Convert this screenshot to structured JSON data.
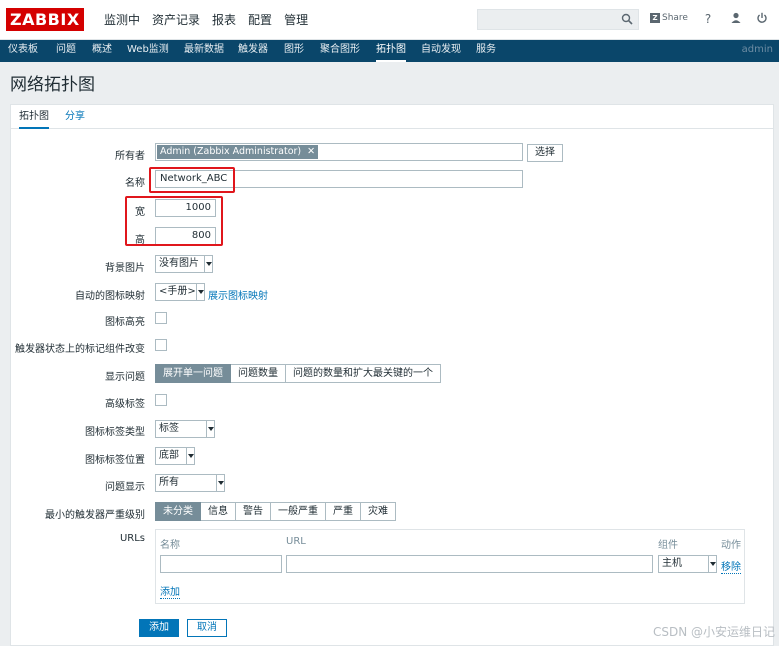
{
  "header": {
    "logo": "ZABBIX",
    "menu": [
      "监测中",
      "资产记录",
      "报表",
      "配置",
      "管理"
    ],
    "share_label": "Share",
    "share_z": "Z",
    "help": "?",
    "user": "admin"
  },
  "subnav": [
    "仪表板",
    "问题",
    "概述",
    "Web监测",
    "最新数据",
    "触发器",
    "图形",
    "聚合图形",
    "拓扑图",
    "自动发现",
    "服务"
  ],
  "page": {
    "title": "网络拓扑图"
  },
  "tabs": {
    "map": "拓扑图",
    "share": "分享"
  },
  "form": {
    "owner_label": "所有者",
    "owner_value": "Admin (Zabbix Administrator)",
    "owner_remove": "✕",
    "select_btn": "选择",
    "name_label": "名称",
    "name_value": "Network_ABC",
    "width_label": "宽",
    "width_value": "1000",
    "height_label": "高",
    "height_value": "800",
    "bg_label": "背景图片",
    "bg_value": "没有图片",
    "iconmap_label": "自动的图标映射",
    "iconmap_value": "<手册>",
    "iconmap_link": "展示图标映射",
    "highlight_label": "图标高亮",
    "trigger_change_label": "触发器状态上的标记组件改变",
    "problems_label": "显示问题",
    "problems_opts": [
      "展开单一问题",
      "问题数量",
      "问题的数量和扩大最关键的一个"
    ],
    "advlabel_label": "高级标签",
    "icon_label_type_label": "图标标签类型",
    "icon_label_type_value": "标签",
    "icon_label_loc_label": "图标标签位置",
    "icon_label_loc_value": "底部",
    "problem_display_label": "问题显示",
    "problem_display_value": "所有",
    "severity_label": "最小的触发器严重级别",
    "severity_opts": [
      "未分类",
      "信息",
      "警告",
      "一般严重",
      "严重",
      "灾难"
    ],
    "urls_label": "URLs",
    "urls_cols": {
      "name": "名称",
      "url": "URL",
      "element": "组件",
      "action": "动作"
    },
    "urls_row": {
      "element_value": "主机",
      "remove": "移除"
    },
    "urls_add": "添加",
    "add_btn": "添加",
    "cancel_btn": "取消"
  },
  "watermark": "CSDN @小安运维日记",
  "colors": {
    "brand": "#d40000",
    "nav": "#0a466a",
    "accent": "#0275b8",
    "highlight_box": "#e0161c"
  }
}
